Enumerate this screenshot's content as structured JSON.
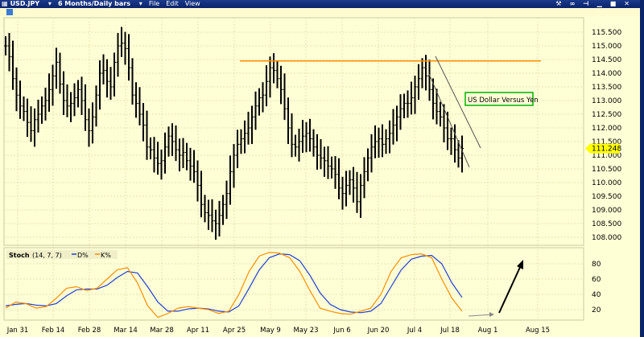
{
  "window": {
    "symbol": "USD.JPY",
    "period": "6 Months/Daily bars",
    "menu": [
      "File",
      "Edit",
      "View"
    ],
    "controls": [
      "wrench-icon",
      "link-icon",
      "pin-icon",
      "minimize-icon",
      "maximize-icon",
      "close-icon"
    ]
  },
  "colors": {
    "resistance": "#ff8c00",
    "k_line": "#ff8c00",
    "d_line": "#1f3fd8",
    "price_tag": "#ffff00",
    "annotation_border": "#00b000"
  },
  "chart_data": [
    {
      "type": "ohlc",
      "title": "USD.JPY 6 Months/Daily bars",
      "ylabel": "",
      "ylim": [
        107.7,
        115.8
      ],
      "yticks": [
        "115.500",
        "115.000",
        "114.500",
        "114.000",
        "113.500",
        "113.000",
        "112.500",
        "112.000",
        "111.500",
        "111.000",
        "110.500",
        "110.000",
        "109.500",
        "109.000",
        "108.500",
        "108.000"
      ],
      "ytick_values": [
        115.5,
        115.0,
        114.5,
        114.0,
        113.5,
        113.0,
        112.5,
        112.0,
        111.5,
        111.0,
        110.5,
        110.0,
        109.5,
        109.0,
        108.5,
        108.0
      ],
      "last_price": "111.248",
      "last_value": 111.248,
      "resistance_level": 114.45,
      "annotation": "US Dollar Versus Yen",
      "closes": [
        115.0,
        114.6,
        113.8,
        113.2,
        112.8,
        112.6,
        112.2,
        111.9,
        112.3,
        112.5,
        112.8,
        113.0,
        113.4,
        113.9,
        114.4,
        113.6,
        113.0,
        112.8,
        112.9,
        113.1,
        113.4,
        113.0,
        112.3,
        111.9,
        112.4,
        113.2,
        114.0,
        114.1,
        113.7,
        113.5,
        114.4,
        115.0,
        115.1,
        114.9,
        114.2,
        113.2,
        112.9,
        112.5,
        112.1,
        111.3,
        111.2,
        110.9,
        110.7,
        110.8,
        111.3,
        111.7,
        111.5,
        111.2,
        111.0,
        111.1,
        110.8,
        110.6,
        110.4,
        109.9,
        109.2,
        108.9,
        108.8,
        108.6,
        108.5,
        108.8,
        109.2,
        109.6,
        110.4,
        111.0,
        111.4,
        111.6,
        111.8,
        112.0,
        112.4,
        112.8,
        113.1,
        113.2,
        113.7,
        114.2,
        114.1,
        113.8,
        113.4,
        112.7,
        112.0,
        111.4,
        111.3,
        111.5,
        111.7,
        111.8,
        111.6,
        111.3,
        111.0,
        110.9,
        110.8,
        110.6,
        110.5,
        110.3,
        109.8,
        109.6,
        109.9,
        110.1,
        109.8,
        109.3,
        109.9,
        110.4,
        110.9,
        111.3,
        111.5,
        111.6,
        111.4,
        111.6,
        111.8,
        112.1,
        112.4,
        112.7,
        112.9,
        112.9,
        113.1,
        113.5,
        113.8,
        114.2,
        113.9,
        113.4,
        112.9,
        112.6,
        112.4,
        112.0,
        111.6,
        111.6,
        111.2,
        110.9,
        111.25
      ]
    },
    {
      "type": "line",
      "title": "Stoch",
      "params": "(14, 7, 7)",
      "legend": [
        "D%",
        "K%"
      ],
      "ylim": [
        0,
        100
      ],
      "yticks": [
        "80",
        "60",
        "40",
        "20"
      ],
      "ytick_values": [
        80,
        60,
        40,
        20
      ],
      "series": [
        {
          "name": "K%",
          "values": [
            22,
            30,
            28,
            22,
            24,
            35,
            48,
            50,
            45,
            48,
            60,
            72,
            75,
            55,
            25,
            10,
            15,
            22,
            24,
            22,
            20,
            15,
            18,
            40,
            70,
            90,
            95,
            94,
            88,
            70,
            45,
            22,
            18,
            15,
            14,
            18,
            22,
            40,
            70,
            88,
            92,
            93,
            88,
            60,
            35,
            18
          ]
        },
        {
          "name": "D%",
          "values": [
            25,
            27,
            28,
            26,
            25,
            28,
            38,
            46,
            47,
            47,
            52,
            62,
            70,
            68,
            50,
            30,
            18,
            18,
            21,
            22,
            21,
            18,
            17,
            25,
            48,
            72,
            88,
            93,
            92,
            84,
            65,
            42,
            27,
            20,
            17,
            16,
            18,
            28,
            50,
            72,
            86,
            90,
            91,
            80,
            55,
            36
          ]
        }
      ]
    },
    {
      "type": "axis",
      "xticks": [
        "Jan 31",
        "Feb 14",
        "Feb 28",
        "Mar 14",
        "Mar 28",
        "Apr 11",
        "Apr 25",
        "May 9",
        "May 23",
        "Jun 6",
        "Jun 20",
        "Jul 4",
        "Jul 18",
        "Aug 1",
        "Aug 15"
      ]
    }
  ]
}
